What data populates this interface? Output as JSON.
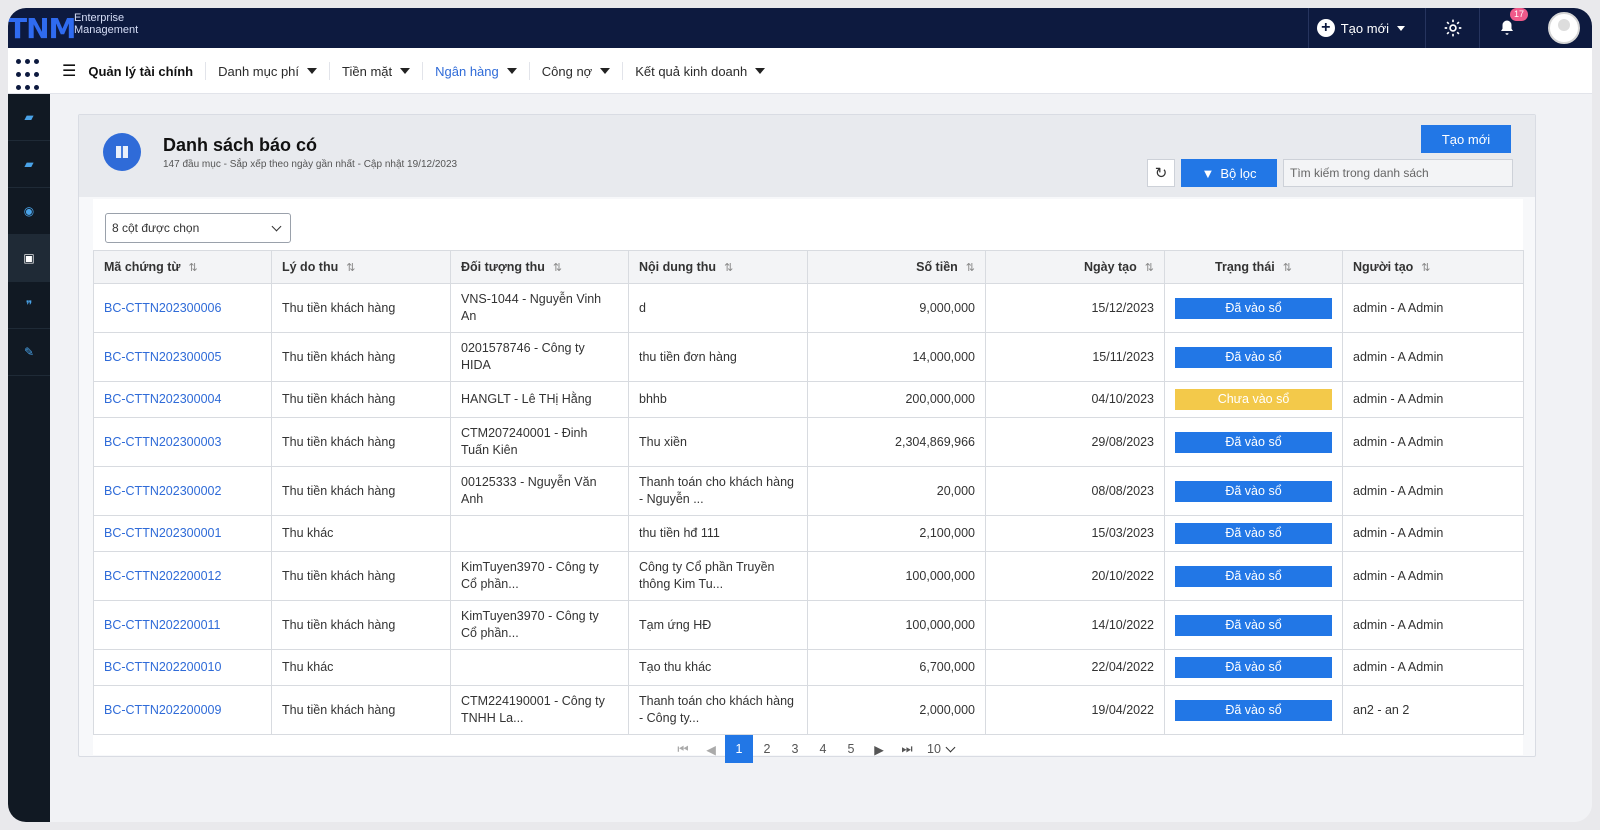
{
  "app": {
    "logo": "TNM",
    "logo_sub_1": "Enterprise",
    "logo_sub_2": "Management",
    "create_new": "Tạo mới",
    "notif_count": "17"
  },
  "menu": {
    "items": [
      {
        "label": "Quản lý tài chính"
      },
      {
        "label": "Danh mục phí"
      },
      {
        "label": "Tiền mặt"
      },
      {
        "label": "Ngân hàng"
      },
      {
        "label": "Công nợ"
      },
      {
        "label": "Kết quả kinh doanh"
      }
    ],
    "active": "Ngân hàng"
  },
  "sidebar": {
    "icons": [
      "book-icon",
      "book-icon",
      "binoculars-icon",
      "document-icon",
      "quote-icon",
      "edit-icon"
    ]
  },
  "page": {
    "title": "Danh sách báo có",
    "subtitle": "147 đầu mục - Sắp xếp theo ngày gần nhất - Cập nhật 19/12/2023",
    "create_button": "Tạo mới",
    "filter_button": "Bộ lọc",
    "search_placeholder": "Tìm kiếm trong danh sách",
    "column_select": "8 cột được chọn"
  },
  "table": {
    "columns": [
      "Mã chứng từ",
      "Lý do thu",
      "Đối tượng thu",
      "Nội dung thu",
      "Số tiền",
      "Ngày tạo",
      "Trạng thái",
      "Người tạo"
    ],
    "rows": [
      {
        "code": "BC-CTTN202300006",
        "reason": "Thu tiền khách hàng",
        "target": "VNS-1044 - Nguyễn Vinh An",
        "content": "d",
        "amount": "9,000,000",
        "date": "15/12/2023",
        "status": "Đã vào sổ",
        "status_color": "#2277e6",
        "creator": "admin - A Admin"
      },
      {
        "code": "BC-CTTN202300005",
        "reason": "Thu tiền khách hàng",
        "target": "0201578746 - Công ty HIDA",
        "content": "thu tiền đơn hàng",
        "amount": "14,000,000",
        "date": "15/11/2023",
        "status": "Đã vào sổ",
        "status_color": "#2277e6",
        "creator": "admin - A Admin"
      },
      {
        "code": "BC-CTTN202300004",
        "reason": "Thu tiền khách hàng",
        "target": "HANGLT - Lê THị Hằng",
        "content": "bhhb",
        "amount": "200,000,000",
        "date": "04/10/2023",
        "status": "Chưa vào sổ",
        "status_color": "#f3c94a",
        "creator": "admin - A Admin"
      },
      {
        "code": "BC-CTTN202300003",
        "reason": "Thu tiền khách hàng",
        "target": "CTM207240001 - Đinh Tuấn Kiên",
        "content": "Thu xiền",
        "amount": "2,304,869,966",
        "date": "29/08/2023",
        "status": "Đã vào sổ",
        "status_color": "#2277e6",
        "creator": "admin - A Admin"
      },
      {
        "code": "BC-CTTN202300002",
        "reason": "Thu tiền khách hàng",
        "target": "00125333 - Nguyễn Văn Anh",
        "content": "Thanh toán cho khách hàng - Nguyễn ...",
        "amount": "20,000",
        "date": "08/08/2023",
        "status": "Đã vào sổ",
        "status_color": "#2277e6",
        "creator": "admin - A Admin"
      },
      {
        "code": "BC-CTTN202300001",
        "reason": "Thu khác",
        "target": "",
        "content": "thu tiền hđ 111",
        "amount": "2,100,000",
        "date": "15/03/2023",
        "status": "Đã vào sổ",
        "status_color": "#2277e6",
        "creator": "admin - A Admin"
      },
      {
        "code": "BC-CTTN202200012",
        "reason": "Thu tiền khách hàng",
        "target": "KimTuyen3970 - Công ty Cổ phần...",
        "content": "Công ty Cổ phần Truyền thông Kim Tu...",
        "amount": "100,000,000",
        "date": "20/10/2022",
        "status": "Đã vào sổ",
        "status_color": "#2277e6",
        "creator": "admin - A Admin"
      },
      {
        "code": "BC-CTTN202200011",
        "reason": "Thu tiền khách hàng",
        "target": "KimTuyen3970 - Công ty Cổ phần...",
        "content": "Tạm ứng HĐ",
        "amount": "100,000,000",
        "date": "14/10/2022",
        "status": "Đã vào sổ",
        "status_color": "#2277e6",
        "creator": "admin - A Admin"
      },
      {
        "code": "BC-CTTN202200010",
        "reason": "Thu khác",
        "target": "",
        "content": "Tạo thu khác",
        "amount": "6,700,000",
        "date": "22/04/2022",
        "status": "Đã vào sổ",
        "status_color": "#2277e6",
        "creator": "admin - A Admin"
      },
      {
        "code": "BC-CTTN202200009",
        "reason": "Thu tiền khách hàng",
        "target": "CTM224190001 - Công ty TNHH La...",
        "content": "Thanh toán cho khách hàng - Công ty...",
        "amount": "2,000,000",
        "date": "19/04/2022",
        "status": "Đã vào sổ",
        "status_color": "#2277e6",
        "creator": "an2 - an 2"
      }
    ]
  },
  "pagination": {
    "pages": [
      "1",
      "2",
      "3",
      "4",
      "5"
    ],
    "current": "1",
    "page_size": "10"
  }
}
